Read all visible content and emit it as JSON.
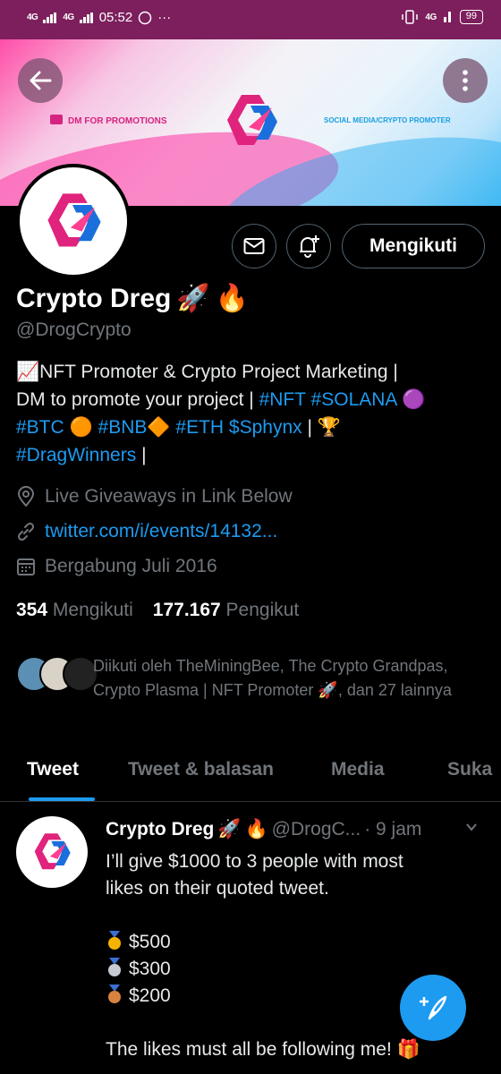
{
  "status_bar": {
    "net1": "4G",
    "net2": "4G",
    "time": "05:52",
    "dots": "···",
    "net3": "4G",
    "battery": "99"
  },
  "banner": {
    "left_text": "DM FOR PROMOTIONS",
    "right_text": "SOCIAL MEDIA/CRYPTO PROMOTER"
  },
  "profile": {
    "name": "Crypto Dreg",
    "handle": "@DrogCrypto",
    "follow_label": "Mengikuti",
    "bio": {
      "line1_text": "NFT Promoter & Crypto Project Marketing |",
      "line2_text": "DM to promote your project |",
      "tag_nft": "#NFT",
      "tag_solana": "#SOLANA",
      "tag_btc": "#BTC",
      "tag_bnb": "#BNB",
      "tag_eth": "#ETH",
      "tag_sphynx": "$Sphynx",
      "sep": "|",
      "tag_dragwinners": "#DragWinners",
      "end": "|"
    },
    "location": "Live Giveaways in Link Below",
    "link": "twitter.com/i/events/14132...",
    "joined": "Bergabung Juli 2016",
    "following_count": "354",
    "following_label": "Mengikuti",
    "followers_count": "177.167",
    "followers_label": "Pengikut",
    "followed_by": "Diikuti oleh TheMiningBee, The Crypto Grandpas, Crypto Plasma | NFT Promoter",
    "followed_by_tail": ", dan 27 lainnya"
  },
  "tabs": [
    {
      "label": "Tweet"
    },
    {
      "label": "Tweet & balasan"
    },
    {
      "label": "Media"
    },
    {
      "label": "Suka"
    }
  ],
  "tweet": {
    "name": "Crypto Dreg",
    "handle": "@DrogC...",
    "time": "· 9 jam",
    "line1": "I’ll give $1000 to 3 people with most",
    "line2": "likes on their quoted tweet.",
    "prize1": "$500",
    "prize2": "$300",
    "prize3": "$200",
    "line_last": "The likes must all be following me!"
  },
  "colors": {
    "accent": "#1d9bf0",
    "status_bar": "#7c1f5c",
    "muted": "#71767b"
  },
  "icons": [
    "back-arrow-icon",
    "more-vertical-icon",
    "mail-icon",
    "bell-plus-icon",
    "location-icon",
    "link-icon",
    "calendar-icon",
    "compose-tweet-icon"
  ]
}
